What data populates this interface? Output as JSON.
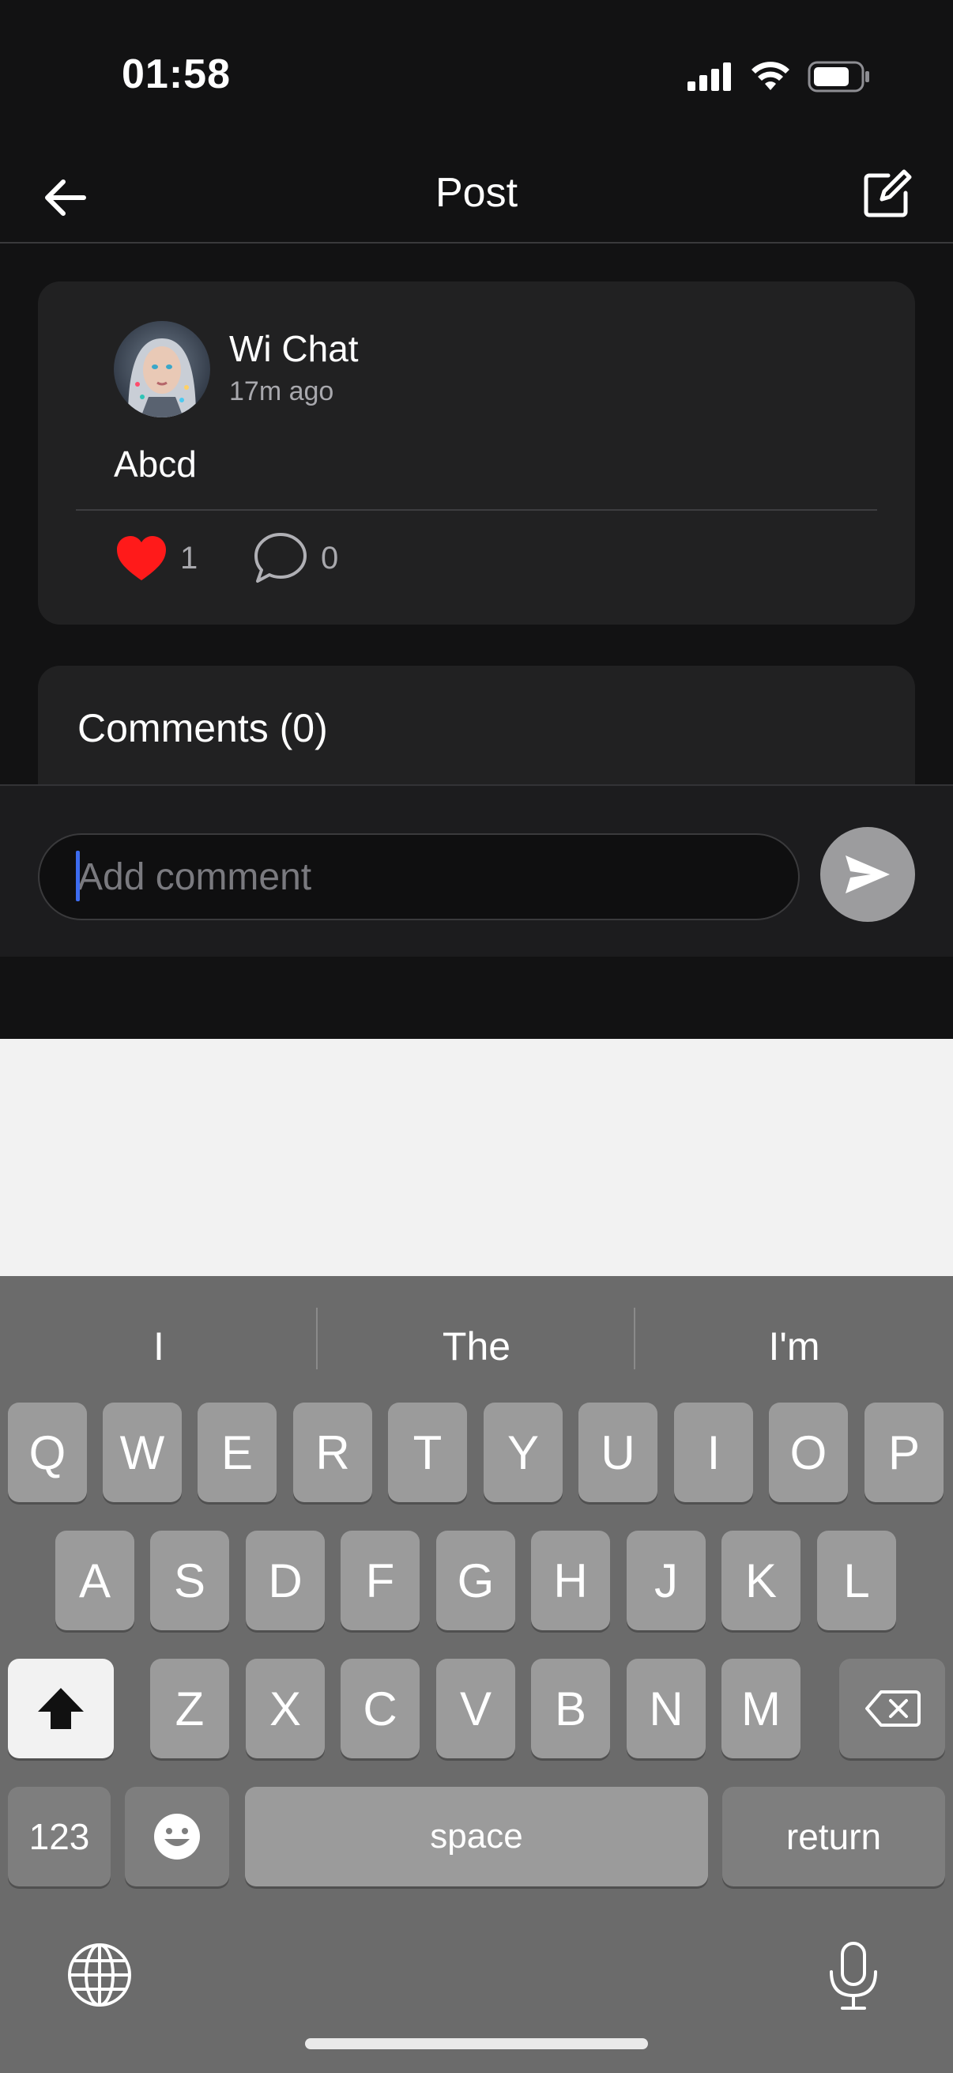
{
  "status": {
    "time": "01:58"
  },
  "nav": {
    "title": "Post"
  },
  "post": {
    "author": "Wi Chat",
    "time_ago": "17m ago",
    "text": "Abcd",
    "likes": "1",
    "comments": "0"
  },
  "comments_section": {
    "title": "Comments (0)"
  },
  "composer": {
    "placeholder": "Add comment"
  },
  "keyboard": {
    "suggestions": [
      "I",
      "The",
      "I'm"
    ],
    "row1": [
      "Q",
      "W",
      "E",
      "R",
      "T",
      "Y",
      "U",
      "I",
      "O",
      "P"
    ],
    "row2": [
      "A",
      "S",
      "D",
      "F",
      "G",
      "H",
      "J",
      "K",
      "L"
    ],
    "row3": [
      "Z",
      "X",
      "C",
      "V",
      "B",
      "N",
      "M"
    ],
    "numbers_label": "123",
    "space_label": "space",
    "return_label": "return"
  },
  "colors": {
    "like": "#ff1a1a",
    "caret": "#3d6cf0",
    "send": "#9c9c9e"
  },
  "icons": [
    "back-arrow-icon",
    "compose-icon",
    "heart-icon",
    "comment-bubble-icon",
    "send-icon",
    "shift-icon",
    "delete-icon",
    "emoji-icon",
    "globe-icon",
    "microphone-icon",
    "signal-icon",
    "wifi-icon",
    "battery-icon"
  ]
}
